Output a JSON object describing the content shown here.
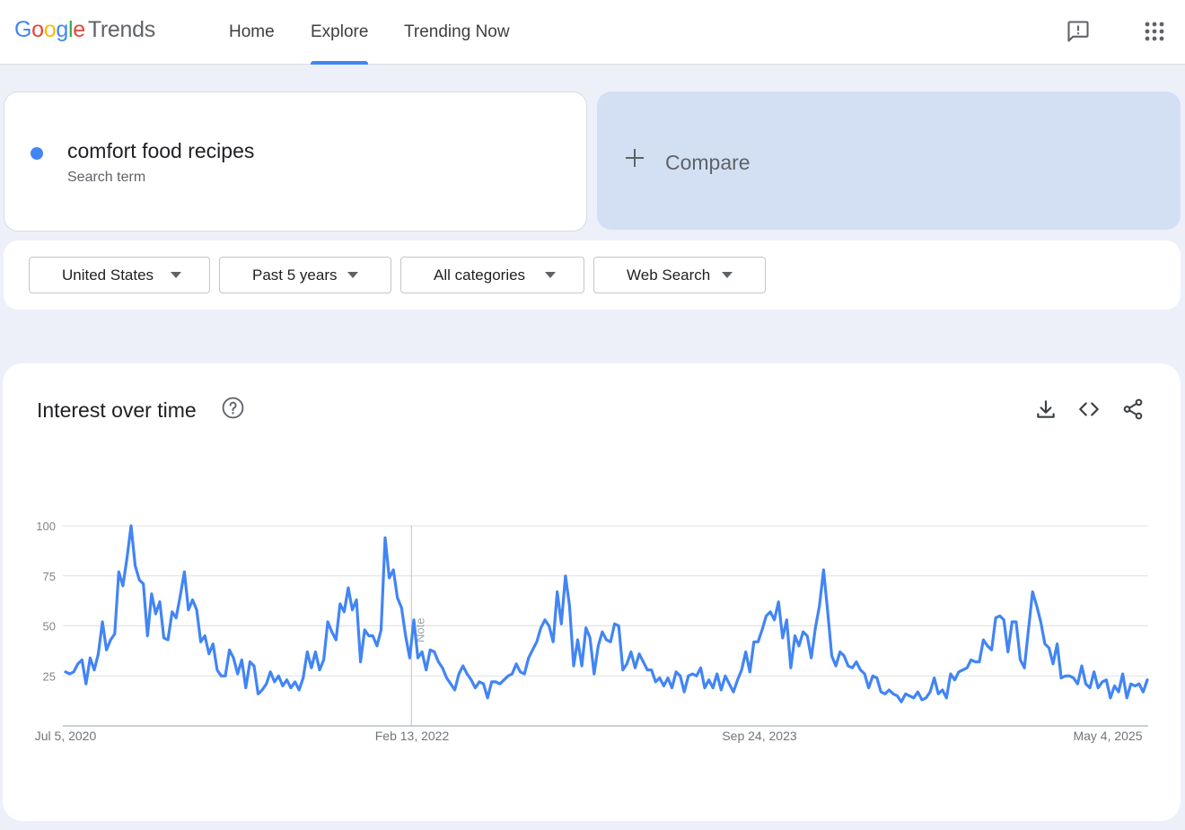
{
  "header": {
    "logo": {
      "google": "Google",
      "product": "Trends"
    },
    "nav": [
      {
        "label": "Home",
        "active": false
      },
      {
        "label": "Explore",
        "active": true
      },
      {
        "label": "Trending Now",
        "active": false
      }
    ],
    "icons": [
      "feedback-icon",
      "apps-grid-icon"
    ]
  },
  "search": {
    "term": "comfort food recipes",
    "term_type": "Search term",
    "term_color": "#4285f4",
    "compare_label": "Compare"
  },
  "filters": {
    "region": "United States",
    "time_range": "Past 5 years",
    "category": "All categories",
    "search_type": "Web Search"
  },
  "card": {
    "title": "Interest over time",
    "tools": [
      "download-icon",
      "embed-code-icon",
      "share-icon"
    ]
  },
  "chart_data": {
    "type": "line",
    "title": "Interest over time",
    "xlabel": "",
    "ylabel": "",
    "ylim": [
      0,
      100
    ],
    "yticks": [
      25,
      50,
      75,
      100
    ],
    "x_tick_labels": [
      "Jul 5, 2020",
      "Feb 13, 2022",
      "Sep 24, 2023",
      "May 4, 2025"
    ],
    "x_start": "2020-07-05",
    "x_end": "2025-05-04",
    "annotation": {
      "label": "Note",
      "date": "2022-01-23"
    },
    "grid": true,
    "legend": "none",
    "color": "#4285f4",
    "series": [
      {
        "name": "comfort food recipes",
        "values": [
          27,
          26,
          27,
          31,
          33,
          21,
          34,
          28,
          36,
          52,
          38,
          43,
          46,
          77,
          70,
          84,
          100,
          80,
          73,
          71,
          45,
          66,
          56,
          62,
          44,
          43,
          57,
          54,
          65,
          77,
          58,
          63,
          58,
          42,
          45,
          36,
          41,
          28,
          25,
          25,
          38,
          34,
          26,
          33,
          19,
          32,
          30,
          16,
          18,
          21,
          27,
          22,
          25,
          20,
          23,
          19,
          22,
          18,
          24,
          37,
          29,
          37,
          28,
          33,
          52,
          47,
          43,
          61,
          57,
          69,
          58,
          63,
          32,
          48,
          45,
          45,
          40,
          48,
          94,
          74,
          78,
          64,
          59,
          45,
          34,
          53,
          34,
          37,
          28,
          38,
          37,
          32,
          29,
          24,
          21,
          18,
          26,
          30,
          26,
          23,
          19,
          22,
          21,
          14,
          22,
          22,
          21,
          23,
          25,
          26,
          31,
          27,
          26,
          34,
          38,
          42,
          49,
          53,
          50,
          42,
          67,
          51,
          75,
          60,
          30,
          43,
          30,
          49,
          44,
          26,
          40,
          47,
          43,
          42,
          51,
          50,
          28,
          31,
          37,
          29,
          36,
          32,
          28,
          28,
          22,
          24,
          20,
          24,
          19,
          27,
          25,
          17,
          25,
          26,
          25,
          29,
          19,
          23,
          19,
          26,
          18,
          25,
          21,
          17,
          23,
          28,
          37,
          27,
          42,
          42,
          48,
          55,
          57,
          53,
          62,
          44,
          53,
          29,
          45,
          40,
          47,
          45,
          34,
          49,
          60,
          78,
          57,
          35,
          30,
          37,
          35,
          30,
          29,
          32,
          28,
          26,
          19,
          25,
          24,
          17,
          16,
          18,
          16,
          15,
          12,
          16,
          15,
          14,
          17,
          13,
          14,
          17,
          24,
          16,
          18,
          14,
          26,
          23,
          27,
          28,
          29,
          33,
          32,
          32,
          43,
          40,
          38,
          54,
          55,
          53,
          37,
          52,
          52,
          33,
          29,
          48,
          67,
          60,
          52,
          41,
          39,
          31,
          41,
          24,
          25,
          25,
          24,
          21,
          30,
          21,
          19,
          27,
          19,
          22,
          23,
          14,
          20,
          17,
          26,
          14,
          21,
          20,
          21,
          17,
          23
        ]
      }
    ]
  }
}
